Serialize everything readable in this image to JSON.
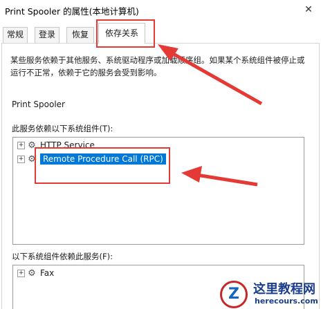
{
  "window": {
    "title": "Print Spooler 的属性(本地计算机)",
    "close_glyph": "✕"
  },
  "tabs": [
    {
      "label": "常规"
    },
    {
      "label": "登录"
    },
    {
      "label": "恢复"
    },
    {
      "label": "依存关系",
      "active": true
    }
  ],
  "description": "某些服务依赖于其他服务、系统驱动程序或加载顺序组。如果某个系统组件被停止或运行不正常，依赖于它的服务会受到影响。",
  "service_name": "Print Spooler",
  "depends_on": {
    "label": "此服务依赖以下系统组件(T):",
    "items": [
      {
        "label": "HTTP Service",
        "icon": "gear-icon"
      },
      {
        "label": "Remote Procedure Call (RPC)",
        "icon": "gear-icon",
        "selected": true
      }
    ]
  },
  "dependents": {
    "label": "以下系统组件依赖此服务(F):",
    "items": [
      {
        "label": "Fax",
        "icon": "gear-icon"
      }
    ]
  },
  "watermark": {
    "title": "这里教程网",
    "url": "herecours.com",
    "logo_letter": "Z"
  },
  "colors": {
    "selection": "#0078d7",
    "annotation": "#e53935",
    "watermark": "#1a3d8f"
  }
}
